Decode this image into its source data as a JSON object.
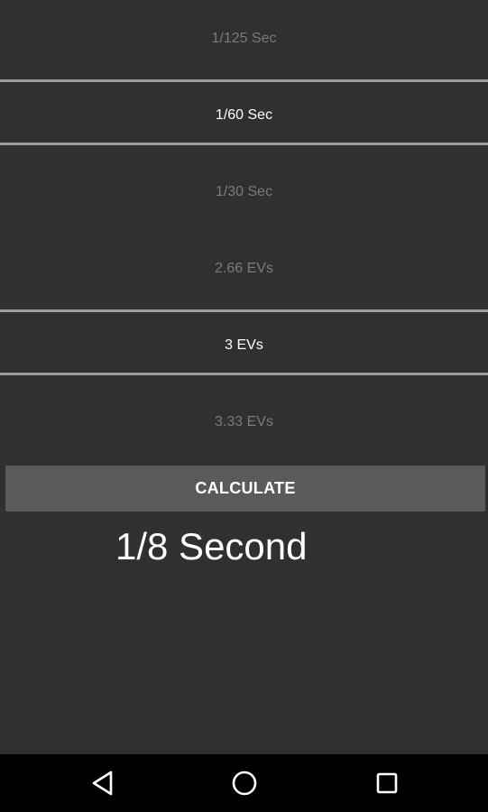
{
  "shutter_picker": {
    "items": [
      {
        "label": "1/125 Sec",
        "selected": false
      },
      {
        "label": "1/60 Sec",
        "selected": true
      },
      {
        "label": "1/30 Sec",
        "selected": false
      }
    ]
  },
  "ev_picker": {
    "items": [
      {
        "label": "2.66 EVs",
        "selected": false
      },
      {
        "label": "3 EVs",
        "selected": true
      },
      {
        "label": "3.33 EVs",
        "selected": false
      }
    ]
  },
  "calculate_button": {
    "label": "CALCULATE"
  },
  "result": {
    "text": "1/8 Second"
  },
  "navbar": {
    "icons": [
      "back-icon",
      "home-icon",
      "recents-icon"
    ]
  },
  "colors": {
    "background": "#303030",
    "divider": "#9e9e9e",
    "button": "#5a5a5a",
    "selected_text": "#ffffff",
    "unselected_text": "#7a7a7a",
    "navbar": "#000000"
  }
}
